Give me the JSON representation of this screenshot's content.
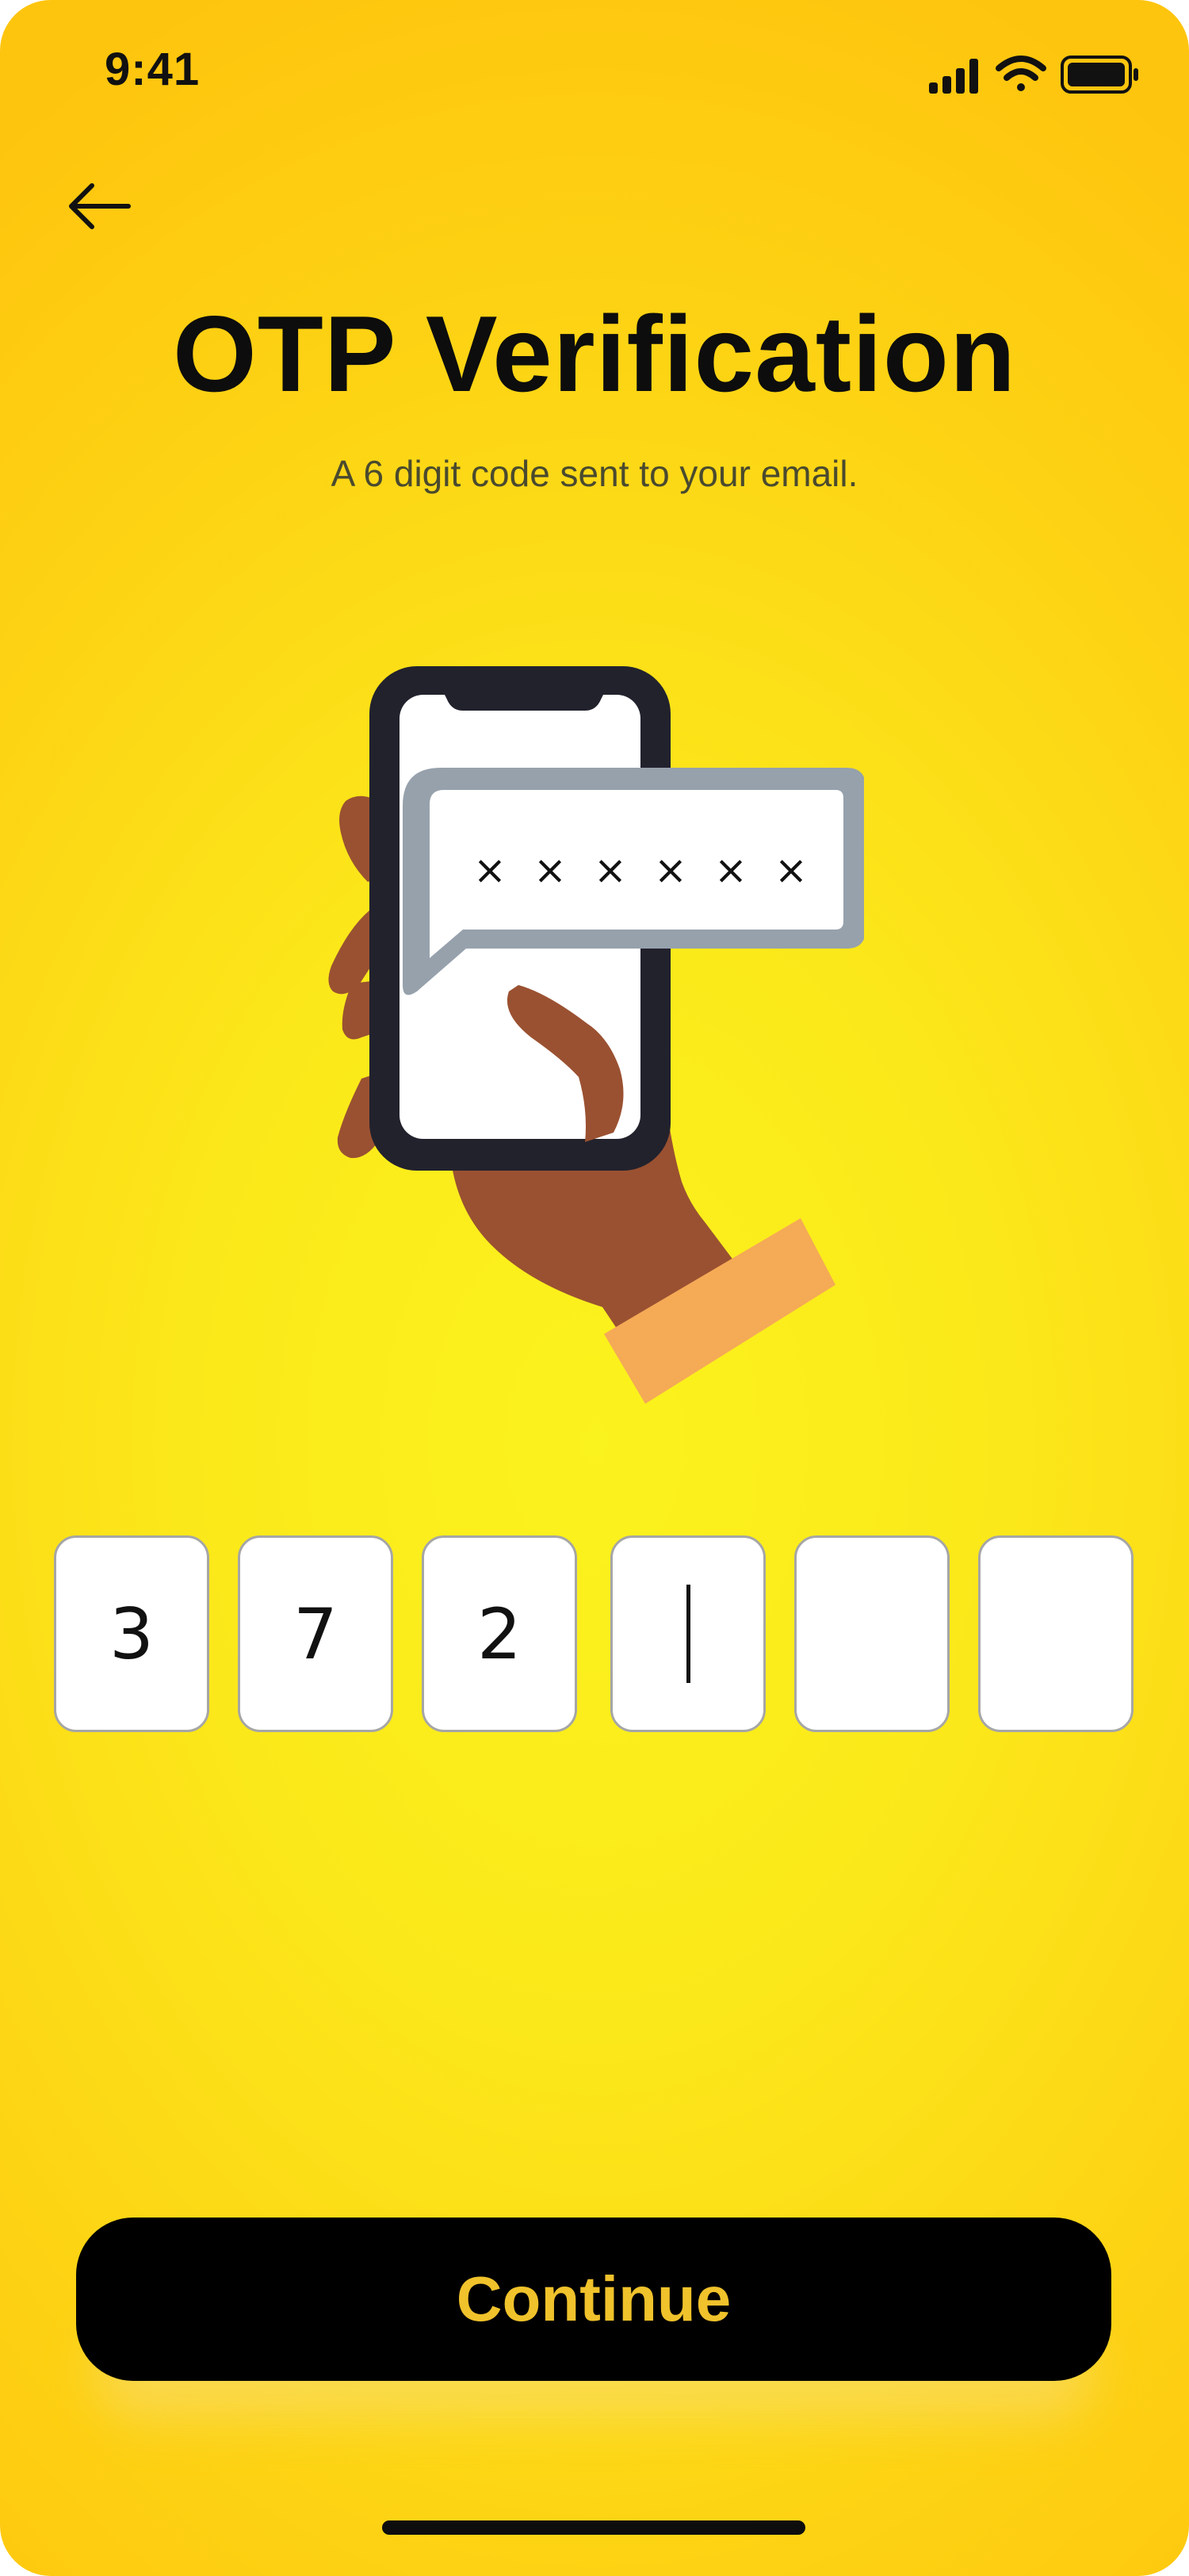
{
  "status_bar": {
    "time": "9:41",
    "icons": [
      "signal-icon",
      "wifi-icon",
      "battery-icon"
    ]
  },
  "header": {
    "back_icon": "arrow-left-icon",
    "title": "OTP Verification",
    "subtitle": "A 6 digit code sent to your email."
  },
  "illustration": {
    "icon": "hand-phone-message-icon",
    "masked_code": [
      "×",
      "×",
      "×",
      "×",
      "×",
      "×"
    ]
  },
  "otp": {
    "digits": [
      "3",
      "7",
      "2",
      "",
      "",
      ""
    ],
    "active_index": 3
  },
  "actions": {
    "continue_label": "Continue"
  },
  "colors": {
    "background_center": "#fbf31d",
    "background_edge": "#fec50e",
    "button_background": "#000000",
    "button_text": "#f0c22b",
    "skin": "#9a5131",
    "sleeve": "#f5aa56",
    "bubble_border": "#96a1ac",
    "phone_frame": "#22222d"
  }
}
